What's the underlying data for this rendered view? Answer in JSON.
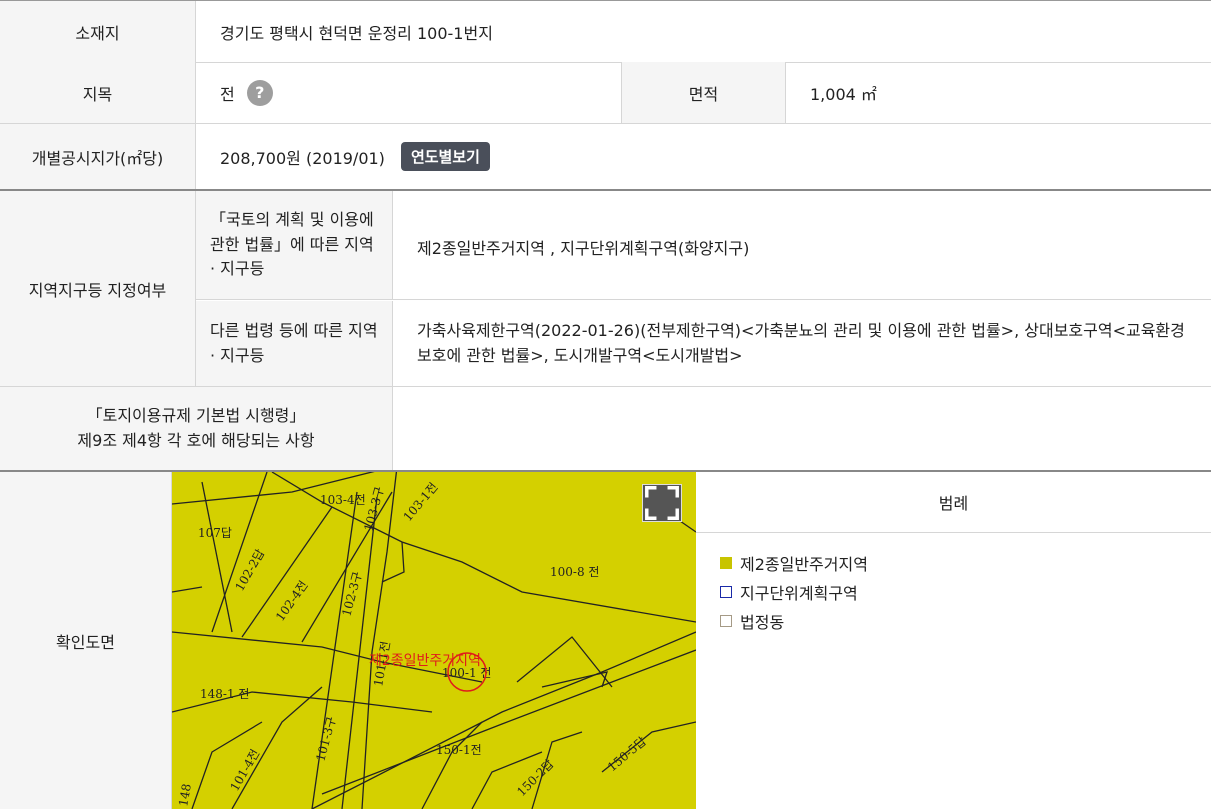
{
  "rows": {
    "location": {
      "label": "소재지",
      "value": "경기도 평택시 현덕면 운정리 100-1번지"
    },
    "category": {
      "label": "지목",
      "value": "전",
      "help_icon": "?",
      "area_label": "면적",
      "area_value": "1,004 ㎡"
    },
    "price": {
      "label": "개별공시지가(㎡당)",
      "value": "208,700원 (2019/01)",
      "button": "연도별보기"
    },
    "zoning": {
      "label": "지역지구등 지정여부",
      "sub1_label": "「국토의 계획 및 이용에 관한 법률」에 따른 지역 · 지구등",
      "sub1_value": "제2종일반주거지역 , 지구단위계획구역(화양지구)",
      "sub2_label": "다른 법령 등에 따른 지역 · 지구등",
      "sub2_value": "가축사육제한구역(2022-01-26)(전부제한구역)<가축분뇨의 관리 및 이용에 관한 법률>, 상대보호구역<교육환경 보호에 관한 법률>, 도시개발구역<도시개발법>"
    },
    "enforcement": {
      "label_line1": "「토지이용규제 기본법 시행령」",
      "label_line2": "제9조 제4항 각 호에 해당되는 사항",
      "value": ""
    },
    "map": {
      "label": "확인도면",
      "legend_title": "범례",
      "legend": [
        {
          "label": "제2종일반주거지역",
          "color": "#c8c400",
          "style": "fill"
        },
        {
          "label": "지구단위계획구역",
          "color": "#1a2aa8",
          "style": "outline"
        },
        {
          "label": "법정동",
          "color": "#a59a86",
          "style": "outline"
        }
      ],
      "parcels": [
        "103-4전",
        "103-3구",
        "103-1전",
        "107답",
        "102-2답",
        "102-4전",
        "102-3구",
        "100-8 전",
        "101-1전",
        "100-1 전",
        "148-1 전",
        "101-3구",
        "101-4전",
        "150-1전",
        "150-2답",
        "150-5답",
        "148"
      ],
      "zone_label": "제2종일반주거지역"
    }
  }
}
